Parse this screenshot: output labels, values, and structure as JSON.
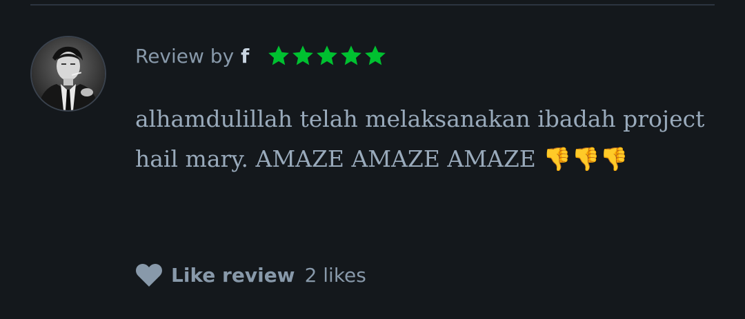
{
  "review": {
    "by_label": "Review by",
    "reviewer_name": "f",
    "rating_stars": 5,
    "star_color": "#00c030",
    "body": "alhamdulillah telah melaksanakan ibadah project hail mary. AMAZE AMAZE AMAZE 👎👎👎",
    "avatar_icon": "profile-photo"
  },
  "like": {
    "icon": "heart-icon",
    "label": "Like review",
    "count_text": "2 likes"
  },
  "colors": {
    "background": "#14181c",
    "divider": "#2c3440",
    "muted_text": "#8899aa",
    "body_text": "#99aabb",
    "name_text": "#c8d4e0",
    "heart": "#8899aa"
  }
}
